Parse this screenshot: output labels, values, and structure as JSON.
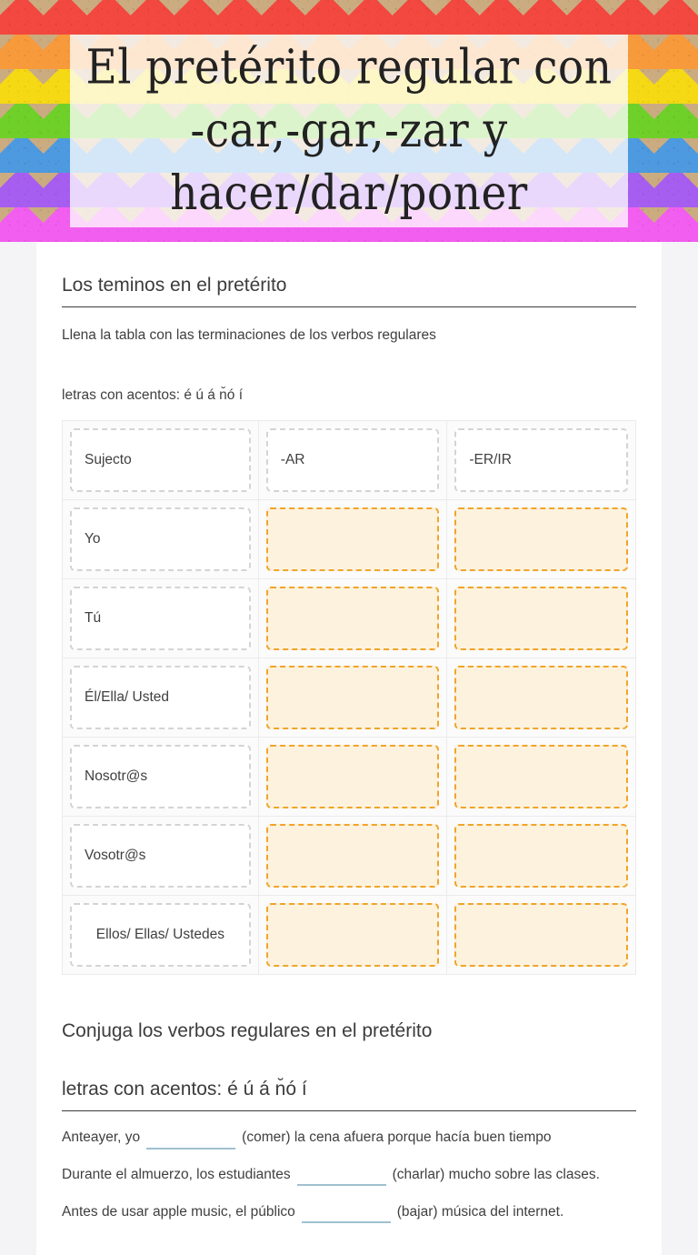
{
  "banner": {
    "title": "El pretérito regular con -car,-gar,-zar y hacer/dar/poner",
    "pattern_name": "rainbow-chevron",
    "stripe_colors": [
      "#f2483f",
      "#f79a3c",
      "#f5d914",
      "#6fd02a",
      "#4d9ae0",
      "#a65ef0",
      "#f25ef0"
    ],
    "kraft_color": "#cbab80"
  },
  "section1": {
    "heading": "Los teminos en el pretérito",
    "instruction": "Llena la tabla con las terminaciones de los verbos regulares",
    "accents_label": "letras con acentos: é  ú  á n̆ó í",
    "table": {
      "headers": [
        "Sujecto",
        "-AR",
        "-ER/IR"
      ],
      "rows": [
        {
          "subject": "Yo",
          "ar": "",
          "erir": ""
        },
        {
          "subject": "Tú",
          "ar": "",
          "erir": ""
        },
        {
          "subject": "Él/Ella/ Usted",
          "ar": "",
          "erir": ""
        },
        {
          "subject": "Nosotr@s",
          "ar": "",
          "erir": ""
        },
        {
          "subject": "Vosotr@s",
          "ar": "",
          "erir": ""
        },
        {
          "subject": "Ellos/ Ellas/ Ustedes",
          "ar": "",
          "erir": ""
        }
      ]
    }
  },
  "section2": {
    "heading": "Conjuga los verbos regulares en el pretérito",
    "accents_label": "letras con acentos: é  ú  á n̆ó í",
    "sentences": [
      {
        "before": "Anteayer, yo",
        "value": "",
        "after": "(comer) la cena afuera porque hacía buen tiempo"
      },
      {
        "before": "Durante el almuerzo, los estudiantes",
        "value": "",
        "after": "(charlar) mucho sobre las clases."
      },
      {
        "before": "Antes de usar apple music, el público",
        "value": "",
        "after": "(bajar) música del internet."
      }
    ]
  },
  "colors": {
    "blank_fill": "#fdf2de",
    "blank_border": "#f0a52a",
    "cell_border": "#d4d4d4",
    "input_underline": "#9fc0cf",
    "page_bg": "#f4f4f7",
    "card_bg": "#ffffff",
    "text": "#3f3f3f"
  }
}
